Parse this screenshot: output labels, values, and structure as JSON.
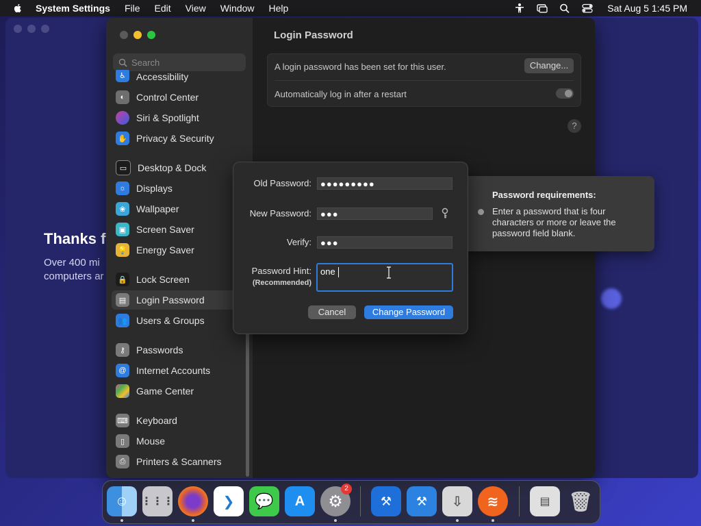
{
  "menubar": {
    "app": "System Settings",
    "items": [
      "File",
      "Edit",
      "View",
      "Window",
      "Help"
    ],
    "clock": "Sat Aug 5  1:45 PM"
  },
  "background_window": {
    "headline": "Thanks f",
    "sub_line1": "Over 400 mi",
    "sub_line2": "computers ar"
  },
  "sidebar": {
    "search_placeholder": "Search",
    "items": [
      {
        "label": "Accessibility",
        "icon": "accessibility-icon",
        "color": "#2f7ce0"
      },
      {
        "label": "Control Center",
        "icon": "control-center-icon",
        "color": "#6e6e6e"
      },
      {
        "label": "Siri & Spotlight",
        "icon": "siri-icon",
        "color": "#c43fa0"
      },
      {
        "label": "Privacy & Security",
        "icon": "hand-icon",
        "color": "#2f7ce0"
      },
      {
        "label": "Desktop & Dock",
        "icon": "desktop-icon",
        "color": "#1c1c1c"
      },
      {
        "label": "Displays",
        "icon": "displays-icon",
        "color": "#2f7ce0"
      },
      {
        "label": "Wallpaper",
        "icon": "wallpaper-icon",
        "color": "#3aa6d9"
      },
      {
        "label": "Screen Saver",
        "icon": "screen-saver-icon",
        "color": "#3ab7c9"
      },
      {
        "label": "Energy Saver",
        "icon": "energy-icon",
        "color": "#e8b437"
      },
      {
        "label": "Lock Screen",
        "icon": "lock-icon",
        "color": "#1c1c1c"
      },
      {
        "label": "Login Password",
        "icon": "login-lock-icon",
        "color": "#7a7a7a"
      },
      {
        "label": "Users & Groups",
        "icon": "users-icon",
        "color": "#2f7ce0"
      },
      {
        "label": "Passwords",
        "icon": "key-icon",
        "color": "#7a7a7a"
      },
      {
        "label": "Internet Accounts",
        "icon": "at-icon",
        "color": "#2f7ce0"
      },
      {
        "label": "Game Center",
        "icon": "game-center-icon",
        "color": "#d9557f"
      },
      {
        "label": "Keyboard",
        "icon": "keyboard-icon",
        "color": "#7a7a7a"
      },
      {
        "label": "Mouse",
        "icon": "mouse-icon",
        "color": "#7a7a7a"
      },
      {
        "label": "Printers & Scanners",
        "icon": "printer-icon",
        "color": "#7a7a7a"
      }
    ],
    "selected": "Login Password"
  },
  "content": {
    "title": "Login Password",
    "password_set_text": "A login password has been set for this user.",
    "change_button": "Change...",
    "auto_login_label": "Automatically log in after a restart",
    "auto_login_enabled": false,
    "help": "?"
  },
  "dialog": {
    "old_password_label": "Old Password:",
    "old_password_value": "●●●●●●●●●",
    "new_password_label": "New Password:",
    "new_password_value": "●●●",
    "verify_label": "Verify:",
    "verify_value": "●●●",
    "hint_label": "Password Hint:",
    "hint_sub": "(Recommended)",
    "hint_value": "one",
    "cancel": "Cancel",
    "confirm": "Change Password"
  },
  "tooltip": {
    "title": "Password requirements:",
    "body": "Enter a password that is four characters or more or leave the password field blank."
  },
  "dock": {
    "settings_badge": "2",
    "apps": [
      "Finder",
      "Launchpad",
      "Firefox",
      "Visual Studio Code",
      "Messages",
      "App Store",
      "System Settings",
      "Xcode",
      "Instruments",
      "Installer",
      "Swift Playgrounds",
      "Downloads",
      "Trash"
    ],
    "colors": {
      "finder": "#3d8fe0",
      "firefox": "#e8642a",
      "vscode": "#1f7ad1",
      "messages": "#3ec94b",
      "appstore": "#1e8ff0"
    }
  },
  "colors": {
    "accent": "#2f7ce0",
    "window_bg": "#1e1e1e",
    "sidebar_bg": "#2b2b2b"
  }
}
